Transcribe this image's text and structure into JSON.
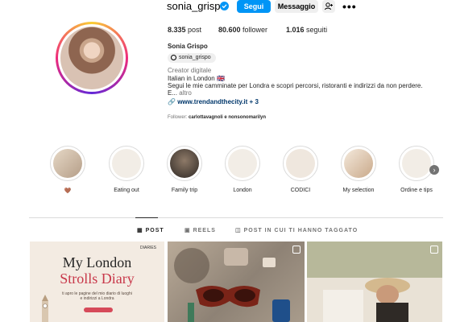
{
  "profile": {
    "username": "sonia_grispo",
    "follow_label": "Segui",
    "message_label": "Messaggio",
    "full_name": "Sonia Grispo",
    "threads_handle": "sonia_grispo",
    "category": "Creator digitale",
    "bio_lines": [
      "Italian in London 🇬🇧",
      "Segui le mie camminate per Londra e scopri percorsi, ristoranti e indirizzi da non perdere.",
      "E..."
    ],
    "bio_more": "altro",
    "link": "www.trendandthecity.it + 3",
    "followers_note_prefix": "Follower: ",
    "followers_note_names": "carlottavagnoli e nonsonomarilyn"
  },
  "stats": {
    "posts_count": "8.335",
    "posts_label": "post",
    "followers_count": "80.600",
    "followers_label": "follower",
    "following_count": "1.016",
    "following_label": "seguiti"
  },
  "highlights": [
    {
      "label": "🤎",
      "color": "#d7c9b8"
    },
    {
      "label": "Eating out",
      "color": "#f2ede6"
    },
    {
      "label": "Family trip",
      "color": "#4a4038"
    },
    {
      "label": "London",
      "color": "#f2ede6"
    },
    {
      "label": "CODICI",
      "color": "#efe7de"
    },
    {
      "label": "My selection",
      "color": "#e8d9c8"
    },
    {
      "label": "Ordine e tips",
      "color": "#f2ede6"
    }
  ],
  "tabs": [
    {
      "label": "POST",
      "active": true
    },
    {
      "label": "REELS",
      "active": false
    },
    {
      "label": "POST IN CUI TI HANNO TAGGATO",
      "active": false
    }
  ],
  "posts": {
    "p1_title_1": "My London",
    "p1_title_2": "Strolls Diary",
    "p1_caption": "ti apro le pagine del mio diario di luoghi e indirizzi a Londra",
    "p1_logo": "DIARIES"
  },
  "colors": {
    "accent": "#0095f6",
    "link": "#00376b",
    "title_red": "#c8384a"
  }
}
